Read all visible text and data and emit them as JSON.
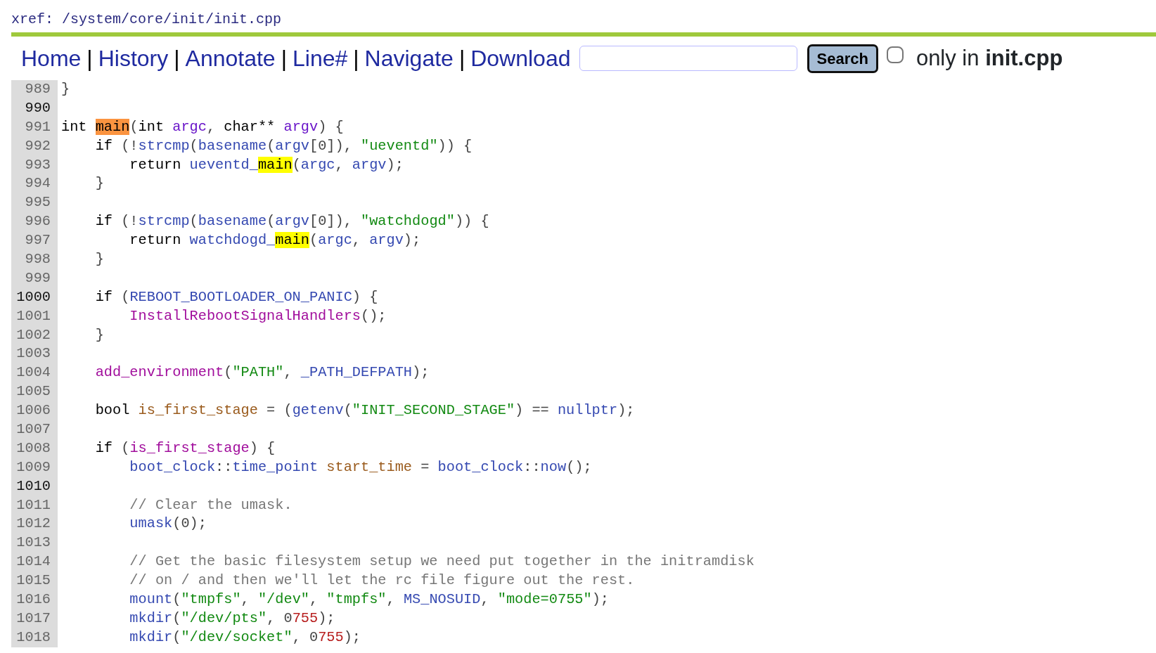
{
  "header": {
    "path": "xref: /system/core/init/init.cpp"
  },
  "nav": [
    {
      "label": "Home",
      "separator": "|"
    },
    {
      "label": "History",
      "separator": "|"
    },
    {
      "label": "Annotate",
      "separator": "|"
    },
    {
      "label": "Line#",
      "separator": "|"
    },
    {
      "label": "Navigate",
      "separator": "|"
    },
    {
      "label": "Download"
    }
  ],
  "search": {
    "button": "Search",
    "only_in_checked": false,
    "only_in_label": "only in **init.cpp**"
  },
  "code": [
    {
      "n": "989",
      "major": false,
      "tokens": [
        {
          "kind": "p",
          "text": "}"
        }
      ]
    },
    {
      "n": "990",
      "major": true
    },
    {
      "n": "991",
      "major": false,
      "tokens": [
        {
          "kind": "kw",
          "text": "int "
        },
        {
          "kind": "hlc",
          "text": "main"
        },
        {
          "kind": "p",
          "text": "("
        },
        {
          "kind": "kw",
          "text": "int "
        },
        {
          "kind": "arg",
          "text": "argc"
        },
        {
          "kind": "p",
          "text": ", "
        },
        {
          "kind": "kw",
          "text": "char** "
        },
        {
          "kind": "arg",
          "text": "argv"
        },
        {
          "kind": "p",
          "text": ") {"
        }
      ]
    },
    {
      "n": "992",
      "major": false,
      "tokens": [
        {
          "kind": "kw",
          "text": "    if "
        },
        {
          "kind": "p",
          "text": "(!"
        },
        {
          "kind": "id",
          "text": "strcmp"
        },
        {
          "kind": "p",
          "text": "("
        },
        {
          "kind": "id",
          "text": "basename"
        },
        {
          "kind": "p",
          "text": "("
        },
        {
          "kind": "id",
          "text": "argv"
        },
        {
          "kind": "p",
          "text": "[0]), "
        },
        {
          "kind": "str",
          "text": "\"ueventd\""
        },
        {
          "kind": "p",
          "text": ")) {"
        }
      ]
    },
    {
      "n": "993",
      "major": false,
      "tokens": [
        {
          "kind": "kw",
          "text": "        return "
        },
        {
          "kind": "id",
          "text": "ueventd_"
        },
        {
          "kind": "hl",
          "text": "main"
        },
        {
          "kind": "p",
          "text": "("
        },
        {
          "kind": "id",
          "text": "argc"
        },
        {
          "kind": "p",
          "text": ", "
        },
        {
          "kind": "id",
          "text": "argv"
        },
        {
          "kind": "p",
          "text": ");"
        }
      ]
    },
    {
      "n": "994",
      "major": false,
      "tokens": [
        {
          "kind": "p",
          "text": "    }"
        }
      ]
    },
    {
      "n": "995",
      "major": false
    },
    {
      "n": "996",
      "major": false,
      "tokens": [
        {
          "kind": "kw",
          "text": "    if "
        },
        {
          "kind": "p",
          "text": "(!"
        },
        {
          "kind": "id",
          "text": "strcmp"
        },
        {
          "kind": "p",
          "text": "("
        },
        {
          "kind": "id",
          "text": "basename"
        },
        {
          "kind": "p",
          "text": "("
        },
        {
          "kind": "id",
          "text": "argv"
        },
        {
          "kind": "p",
          "text": "[0]), "
        },
        {
          "kind": "str",
          "text": "\"watchdogd\""
        },
        {
          "kind": "p",
          "text": ")) {"
        }
      ]
    },
    {
      "n": "997",
      "major": false,
      "tokens": [
        {
          "kind": "kw",
          "text": "        return "
        },
        {
          "kind": "id",
          "text": "watchdogd_"
        },
        {
          "kind": "hl",
          "text": "main"
        },
        {
          "kind": "p",
          "text": "("
        },
        {
          "kind": "id",
          "text": "argc"
        },
        {
          "kind": "p",
          "text": ", "
        },
        {
          "kind": "id",
          "text": "argv"
        },
        {
          "kind": "p",
          "text": ");"
        }
      ]
    },
    {
      "n": "998",
      "major": false,
      "tokens": [
        {
          "kind": "p",
          "text": "    }"
        }
      ]
    },
    {
      "n": "999",
      "major": false
    },
    {
      "n": "1000",
      "major": true,
      "tokens": [
        {
          "kind": "kw",
          "text": "    if "
        },
        {
          "kind": "p",
          "text": "("
        },
        {
          "kind": "id",
          "text": "REBOOT_BOOTLOADER_ON_PANIC"
        },
        {
          "kind": "p",
          "text": ") {"
        }
      ]
    },
    {
      "n": "1001",
      "major": false,
      "tokens": [
        {
          "kind": "fn",
          "text": "        InstallRebootSignalHandlers"
        },
        {
          "kind": "p",
          "text": "();"
        }
      ]
    },
    {
      "n": "1002",
      "major": false,
      "tokens": [
        {
          "kind": "p",
          "text": "    }"
        }
      ]
    },
    {
      "n": "1003",
      "major": false
    },
    {
      "n": "1004",
      "major": false,
      "tokens": [
        {
          "kind": "fn",
          "text": "    add_environment"
        },
        {
          "kind": "p",
          "text": "("
        },
        {
          "kind": "str",
          "text": "\"PATH\""
        },
        {
          "kind": "p",
          "text": ", "
        },
        {
          "kind": "id",
          "text": "_PATH_DEFPATH"
        },
        {
          "kind": "p",
          "text": ");"
        }
      ]
    },
    {
      "n": "1005",
      "major": false
    },
    {
      "n": "1006",
      "major": false,
      "tokens": [
        {
          "kind": "kw",
          "text": "    bool "
        },
        {
          "kind": "var",
          "text": "is_first_stage"
        },
        {
          "kind": "p",
          "text": " = ("
        },
        {
          "kind": "id",
          "text": "getenv"
        },
        {
          "kind": "p",
          "text": "("
        },
        {
          "kind": "str",
          "text": "\"INIT_SECOND_STAGE\""
        },
        {
          "kind": "p",
          "text": ") == "
        },
        {
          "kind": "id",
          "text": "nullptr"
        },
        {
          "kind": "p",
          "text": ");"
        }
      ]
    },
    {
      "n": "1007",
      "major": false
    },
    {
      "n": "1008",
      "major": false,
      "tokens": [
        {
          "kind": "kw",
          "text": "    if "
        },
        {
          "kind": "p",
          "text": "("
        },
        {
          "kind": "fn",
          "text": "is_first_stage"
        },
        {
          "kind": "p",
          "text": ") {"
        }
      ]
    },
    {
      "n": "1009",
      "major": false,
      "tokens": [
        {
          "kind": "id",
          "text": "        boot_clock"
        },
        {
          "kind": "p",
          "text": "::"
        },
        {
          "kind": "id",
          "text": "time_point "
        },
        {
          "kind": "var",
          "text": "start_time"
        },
        {
          "kind": "p",
          "text": " = "
        },
        {
          "kind": "id",
          "text": "boot_clock"
        },
        {
          "kind": "p",
          "text": "::"
        },
        {
          "kind": "id",
          "text": "now"
        },
        {
          "kind": "p",
          "text": "();"
        }
      ]
    },
    {
      "n": "1010",
      "major": true
    },
    {
      "n": "1011",
      "major": false,
      "tokens": [
        {
          "kind": "com",
          "text": "        // Clear the umask."
        }
      ]
    },
    {
      "n": "1012",
      "major": false,
      "tokens": [
        {
          "kind": "id",
          "text": "        umask"
        },
        {
          "kind": "p",
          "text": "(0);"
        }
      ]
    },
    {
      "n": "1013",
      "major": false
    },
    {
      "n": "1014",
      "major": false,
      "tokens": [
        {
          "kind": "com",
          "text": "        // Get the basic filesystem setup we need put together in the initramdisk"
        }
      ]
    },
    {
      "n": "1015",
      "major": false,
      "tokens": [
        {
          "kind": "com",
          "text": "        // on / and then we'll let the rc file figure out the rest."
        }
      ]
    },
    {
      "n": "1016",
      "major": false,
      "tokens": [
        {
          "kind": "id",
          "text": "        mount"
        },
        {
          "kind": "p",
          "text": "("
        },
        {
          "kind": "str",
          "text": "\"tmpfs\""
        },
        {
          "kind": "p",
          "text": ", "
        },
        {
          "kind": "str",
          "text": "\"/dev\""
        },
        {
          "kind": "p",
          "text": ", "
        },
        {
          "kind": "str",
          "text": "\"tmpfs\""
        },
        {
          "kind": "p",
          "text": ", "
        },
        {
          "kind": "id",
          "text": "MS_NOSUID"
        },
        {
          "kind": "p",
          "text": ", "
        },
        {
          "kind": "str",
          "text": "\"mode=0755\""
        },
        {
          "kind": "p",
          "text": ");"
        }
      ]
    },
    {
      "n": "1017",
      "major": false,
      "tokens": [
        {
          "kind": "id",
          "text": "        mkdir"
        },
        {
          "kind": "p",
          "text": "("
        },
        {
          "kind": "str",
          "text": "\"/dev/pts\""
        },
        {
          "kind": "p",
          "text": ", 0"
        },
        {
          "kind": "num",
          "text": "755"
        },
        {
          "kind": "p",
          "text": ");"
        }
      ]
    },
    {
      "n": "1018",
      "major": false,
      "tokens": [
        {
          "kind": "id",
          "text": "        mkdir"
        },
        {
          "kind": "p",
          "text": "("
        },
        {
          "kind": "str",
          "text": "\"/dev/socket\""
        },
        {
          "kind": "p",
          "text": ", 0"
        },
        {
          "kind": "num",
          "text": "755"
        },
        {
          "kind": "p",
          "text": ");"
        }
      ]
    }
  ]
}
